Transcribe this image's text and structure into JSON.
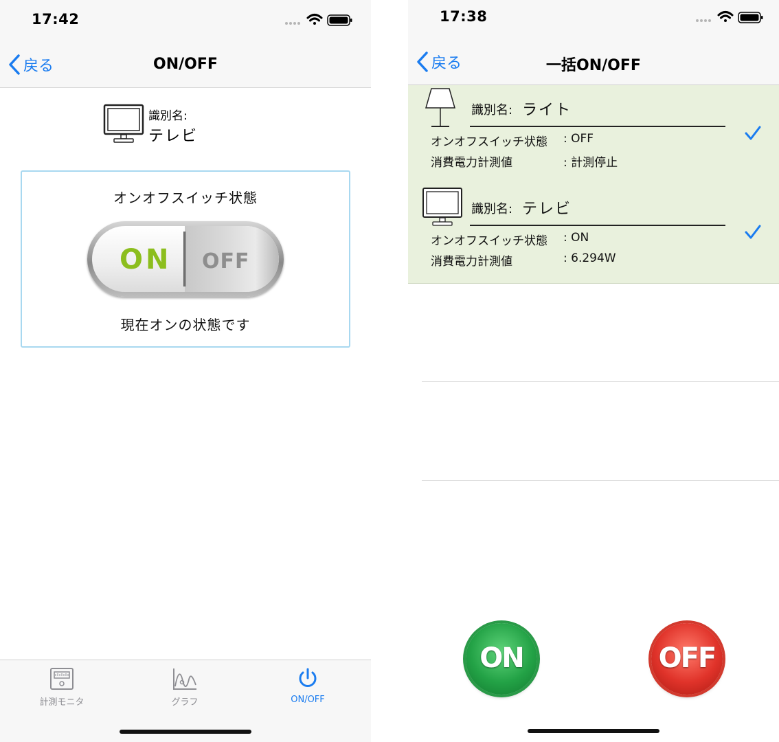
{
  "left": {
    "status": {
      "time": "17:42"
    },
    "nav": {
      "back_label": "戻る",
      "title": "ON/OFF"
    },
    "device": {
      "id_label": "識別名:",
      "id_value": "テレビ"
    },
    "panel": {
      "title": "オンオフスイッチ状態",
      "on_label": "ON",
      "off_label": "OFF",
      "state_text": "現在オンの状態です"
    },
    "tabs": [
      {
        "label": "計測モニタ",
        "icon": "meter-icon",
        "active": false
      },
      {
        "label": "グラフ",
        "icon": "graph-icon",
        "active": false
      },
      {
        "label": "ON/OFF",
        "icon": "power-icon",
        "active": true
      }
    ]
  },
  "right": {
    "status": {
      "time": "17:38"
    },
    "nav": {
      "back_label": "戻る",
      "title": "一括ON/OFF"
    },
    "rows": [
      {
        "icon": "lamp-icon",
        "id_label": "識別名:",
        "id_value": "ライト",
        "switch_label": "オンオフスイッチ状態",
        "switch_value": ": OFF",
        "power_label": "消費電力計測値",
        "power_value": ": 計測停止",
        "checked": true
      },
      {
        "icon": "tv-icon",
        "id_label": "識別名:",
        "id_value": "テレビ",
        "switch_label": "オンオフスイッチ状態",
        "switch_value": ": ON",
        "power_label": "消費電力計測値",
        "power_value": ": 6.294W",
        "checked": true
      }
    ],
    "buttons": {
      "on_label": "ON",
      "off_label": "OFF"
    }
  },
  "colors": {
    "ios_blue": "#1a7cf0",
    "row_bg": "#e9f1dd",
    "on_green": "#8cbe1e",
    "panel_border": "#a8d8f0"
  }
}
